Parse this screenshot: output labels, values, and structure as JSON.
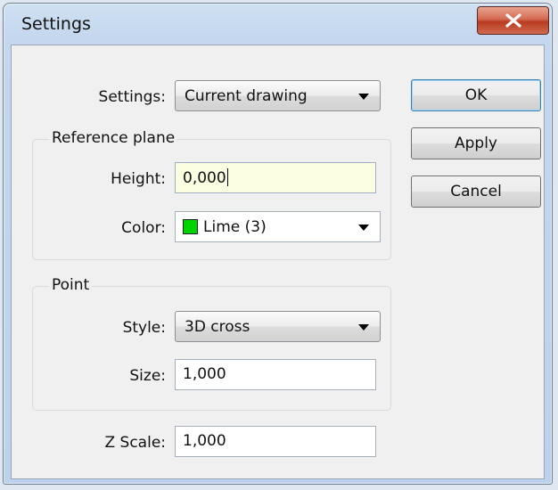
{
  "window": {
    "title": "Settings",
    "close_icon": "close-icon"
  },
  "settings": {
    "label": "Settings:",
    "value": "Current drawing"
  },
  "reference_plane": {
    "group_title": "Reference plane",
    "height_label": "Height:",
    "height_value": "0,000",
    "color_label": "Color:",
    "color_value": "Lime (3)",
    "color_swatch": "#00d400"
  },
  "point": {
    "group_title": "Point",
    "style_label": "Style:",
    "style_value": "3D cross",
    "size_label": "Size:",
    "size_value": "1,000"
  },
  "z_scale": {
    "label": "Z Scale:",
    "value": "1,000"
  },
  "buttons": {
    "ok": "OK",
    "apply": "Apply",
    "cancel": "Cancel"
  }
}
